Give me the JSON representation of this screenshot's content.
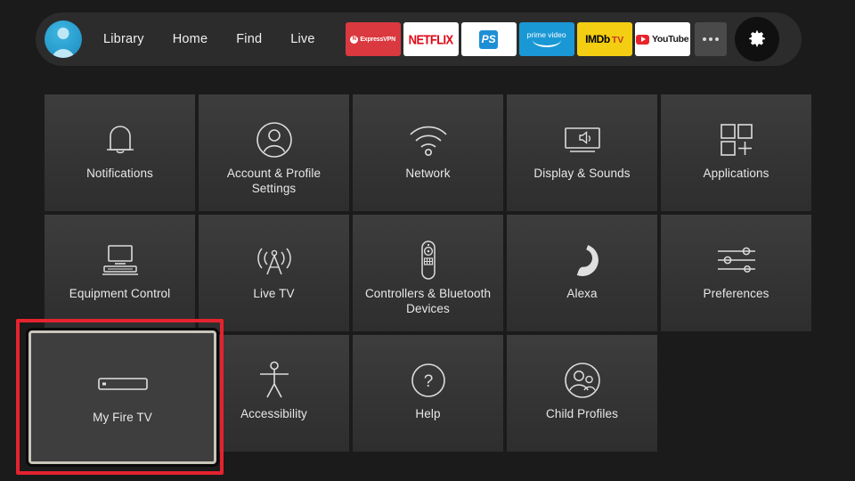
{
  "theme": {
    "page_bg": "#1b1b1b",
    "topbar_bg": "#2c2c2c",
    "tile_bg": "#3a3a3a",
    "focus_red": "#e4232f",
    "focus_border": "#c9c5ba",
    "text": "#e8e8e8"
  },
  "topbar": {
    "avatar_name": "user-avatar",
    "nav": [
      {
        "label": "Library",
        "name": "nav-library"
      },
      {
        "label": "Home",
        "name": "nav-home"
      },
      {
        "label": "Find",
        "name": "nav-find"
      },
      {
        "label": "Live",
        "name": "nav-live"
      }
    ],
    "apps": [
      {
        "label": "ExpressVPN",
        "name": "app-expressvpn",
        "brand": "#da3940"
      },
      {
        "label": "NETFLIX",
        "name": "app-netflix",
        "brand": "#e10514"
      },
      {
        "label": "PS",
        "name": "app-playstation",
        "brand": "#1e8fd5"
      },
      {
        "label": "prime video",
        "name": "app-prime-video",
        "brand": "#1a98d5"
      },
      {
        "label": "IMDb TV",
        "name": "app-imdb-tv",
        "brand": "#f3ce13"
      },
      {
        "label": "YouTube",
        "name": "app-youtube",
        "brand": "#e8242a"
      }
    ],
    "more_label": "more-apps",
    "settings_label": "settings-gear",
    "icons": {
      "more": "ellipsis-icon",
      "settings": "gear-icon"
    }
  },
  "grid": {
    "rows": [
      [
        {
          "label": "Notifications",
          "icon": "bell-icon",
          "name": "tile-notifications"
        },
        {
          "label": "Account & Profile Settings",
          "icon": "person-circle-icon",
          "name": "tile-account-profile-settings"
        },
        {
          "label": "Network",
          "icon": "wifi-icon",
          "name": "tile-network"
        },
        {
          "label": "Display & Sounds",
          "icon": "tv-speaker-icon",
          "name": "tile-display-sounds"
        },
        {
          "label": "Applications",
          "icon": "app-squares-plus-icon",
          "name": "tile-applications"
        }
      ],
      [
        {
          "label": "Equipment Control",
          "icon": "monitor-keyboard-icon",
          "name": "tile-equipment-control"
        },
        {
          "label": "Live TV",
          "icon": "antenna-tower-icon",
          "name": "tile-live-tv"
        },
        {
          "label": "Controllers & Bluetooth Devices",
          "icon": "remote-control-icon",
          "name": "tile-controllers-bluetooth"
        },
        {
          "label": "Alexa",
          "icon": "alexa-ring-icon",
          "name": "tile-alexa"
        },
        {
          "label": "Preferences",
          "icon": "sliders-icon",
          "name": "tile-preferences"
        }
      ],
      [
        {
          "label": "My Fire TV",
          "icon": "fire-tv-stick-icon",
          "name": "tile-my-fire-tv",
          "focused": true
        },
        {
          "label": "Accessibility",
          "icon": "accessibility-icon",
          "name": "tile-accessibility"
        },
        {
          "label": "Help",
          "icon": "question-circle-icon",
          "name": "tile-help"
        },
        {
          "label": "Child Profiles",
          "icon": "child-profiles-icon",
          "name": "tile-child-profiles"
        }
      ]
    ]
  }
}
